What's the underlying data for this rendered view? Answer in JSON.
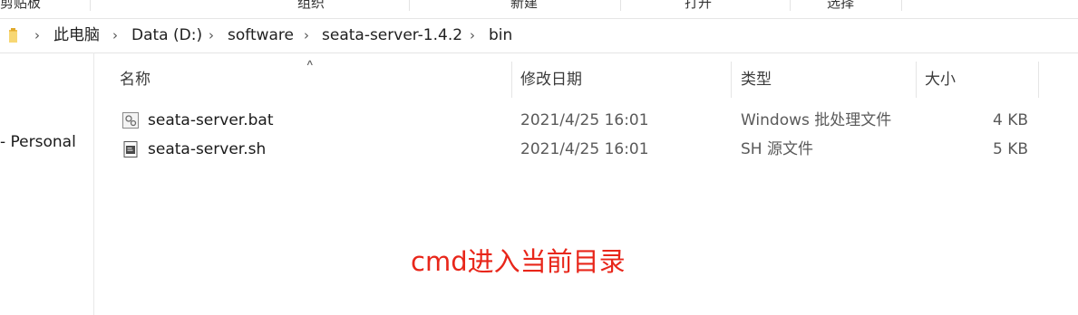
{
  "ribbon": {
    "groups": [
      "剪贴板",
      "组织",
      "新建",
      "打开",
      "选择"
    ]
  },
  "address_bar": {
    "crumbs": [
      "此电脑",
      "Data (D:)",
      "software",
      "seata-server-1.4.2",
      "bin"
    ]
  },
  "nav_pane": {
    "items": [
      "- Personal"
    ]
  },
  "columns": {
    "name": "名称",
    "date": "修改日期",
    "type": "类型",
    "size": "大小"
  },
  "files": [
    {
      "name": "seata-server.bat",
      "date": "2021/4/25 16:01",
      "type": "Windows 批处理文件",
      "size": "4 KB",
      "icon": "batch-file-icon"
    },
    {
      "name": "seata-server.sh",
      "date": "2021/4/25 16:01",
      "type": "SH 源文件",
      "size": "5 KB",
      "icon": "script-file-icon"
    }
  ],
  "annotation": "cmd进入当前目录",
  "colors": {
    "annotation": "#e8261a",
    "folder": "#f2c14e"
  }
}
